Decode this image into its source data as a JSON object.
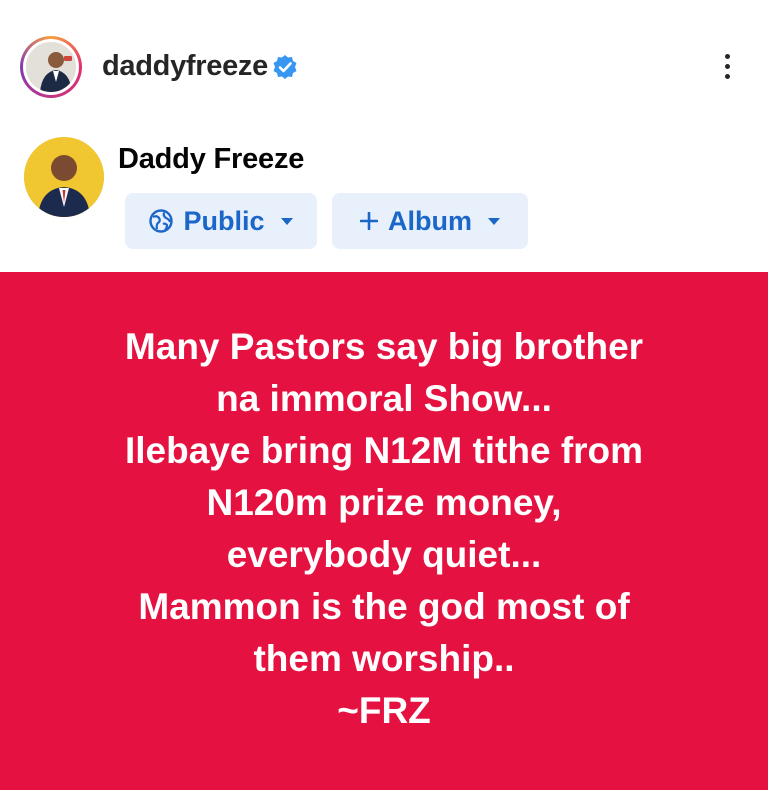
{
  "instagram": {
    "username": "daddyfreeze",
    "verified": true,
    "more_icon": "more-vertical-icon"
  },
  "facebook_post": {
    "author_name": "Daddy Freeze",
    "audience_label": "Public",
    "audience_icon": "globe-icon",
    "album_label": "Album",
    "album_icon": "plus-icon"
  },
  "card": {
    "background_color": "#e51241",
    "text_color": "#ffffff",
    "lines": [
      "Many Pastors say big brother",
      "na immoral Show...",
      "Ilebaye bring N12M tithe from",
      "N120m prize money,",
      "everybody quiet...",
      "Mammon is the god most of",
      "them worship..",
      "~FRZ"
    ]
  },
  "colors": {
    "verified_blue": "#3897f0",
    "chip_bg": "#e7f0fb",
    "chip_text": "#1b66c9"
  }
}
